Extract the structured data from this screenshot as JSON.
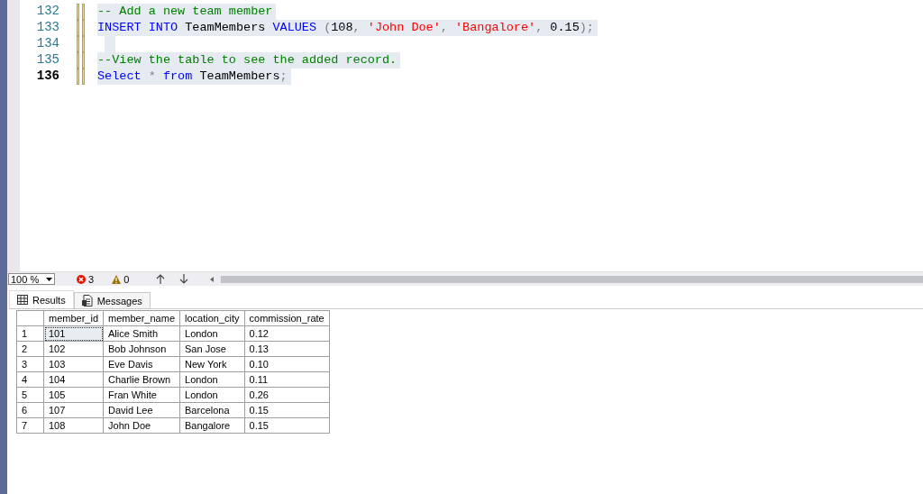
{
  "editor": {
    "lines": [
      {
        "number": "132",
        "current": false,
        "selected": true,
        "tokens": [
          {
            "kind": "comment",
            "text": "-- Add a new team member"
          }
        ]
      },
      {
        "number": "133",
        "current": false,
        "selected": true,
        "tokens": [
          {
            "kind": "keyword",
            "text": "INSERT INTO"
          },
          {
            "kind": "plain",
            "text": " TeamMembers "
          },
          {
            "kind": "keyword",
            "text": "VALUES"
          },
          {
            "kind": "operator",
            "text": " ("
          },
          {
            "kind": "plain",
            "text": "108"
          },
          {
            "kind": "operator",
            "text": ", "
          },
          {
            "kind": "string",
            "text": "'John Doe'"
          },
          {
            "kind": "operator",
            "text": ", "
          },
          {
            "kind": "string",
            "text": "'Bangalore'"
          },
          {
            "kind": "operator",
            "text": ","
          },
          {
            "kind": "plain",
            "text": " 0.15"
          },
          {
            "kind": "operator",
            "text": ");"
          }
        ]
      },
      {
        "number": "134",
        "current": false,
        "selected": true
      },
      {
        "number": "135",
        "current": false,
        "selected": true,
        "tokens": [
          {
            "kind": "comment",
            "text": "--View the table to see the added record."
          }
        ]
      },
      {
        "number": "136",
        "current": true,
        "selected": true,
        "tokens": [
          {
            "kind": "keyword",
            "text": "Select"
          },
          {
            "kind": "operator",
            "text": " * "
          },
          {
            "kind": "keyword",
            "text": "from"
          },
          {
            "kind": "plain",
            "text": " TeamMembers"
          },
          {
            "kind": "operator",
            "text": ";"
          }
        ]
      }
    ]
  },
  "status": {
    "zoom": "100 %",
    "errors": "3",
    "warnings": "0"
  },
  "tabs": [
    {
      "label": "Results",
      "selected": true
    },
    {
      "label": "Messages",
      "selected": false
    }
  ],
  "table": {
    "columns": [
      "member_id",
      "member_name",
      "location_city",
      "commission_rate"
    ],
    "rows": [
      {
        "number": "1",
        "focused": true,
        "cells": [
          "101",
          "Alice Smith",
          "London",
          "0.12"
        ]
      },
      {
        "number": "2",
        "focused": false,
        "cells": [
          "102",
          "Bob Johnson",
          "San Jose",
          "0.13"
        ]
      },
      {
        "number": "3",
        "focused": false,
        "cells": [
          "103",
          "Eve Davis",
          "New York",
          "0.10"
        ]
      },
      {
        "number": "4",
        "focused": false,
        "cells": [
          "104",
          "Charlie Brown",
          "London",
          "0.11"
        ]
      },
      {
        "number": "5",
        "focused": false,
        "cells": [
          "105",
          "Fran White",
          "London",
          "0.26"
        ]
      },
      {
        "number": "6",
        "focused": false,
        "cells": [
          "107",
          "David Lee",
          "Barcelona",
          "0.15"
        ]
      },
      {
        "number": "7",
        "focused": false,
        "cells": [
          "108",
          "John Doe",
          "Bangalore",
          "0.15"
        ]
      }
    ]
  }
}
